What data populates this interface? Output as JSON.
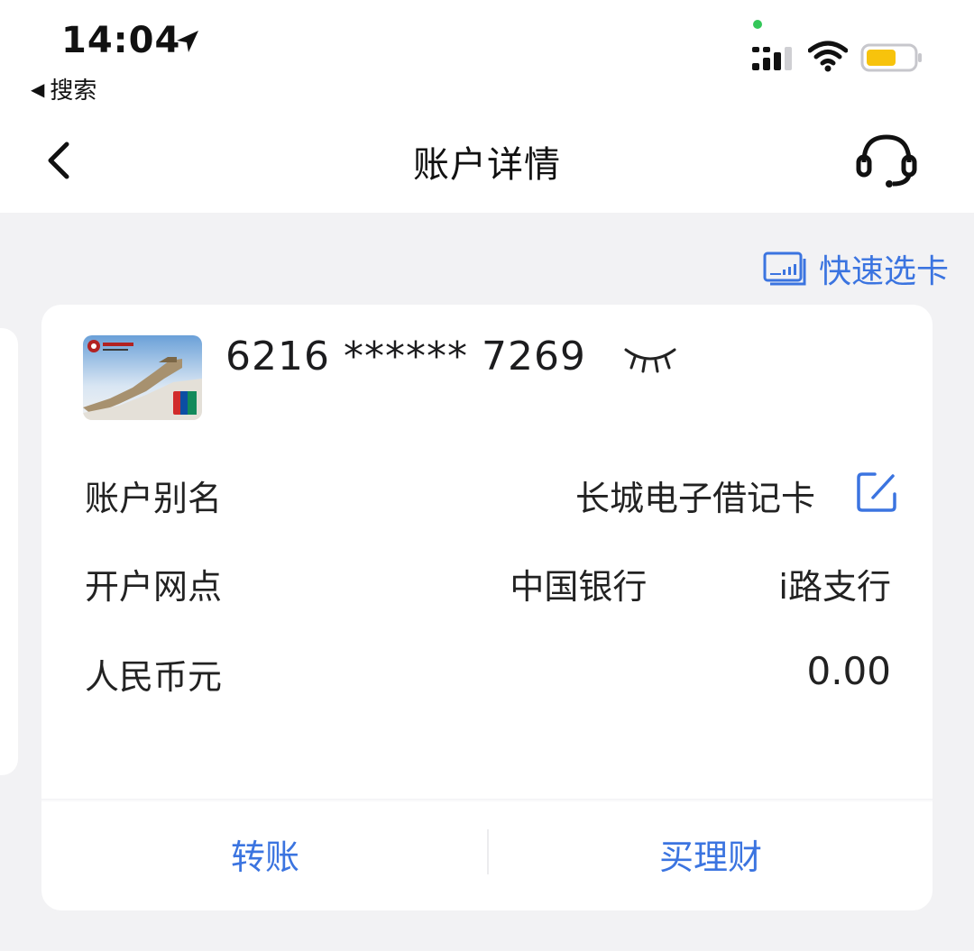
{
  "status_bar": {
    "time": "14:04",
    "back_app_label": "搜索",
    "back_arrow_glyph": "◀"
  },
  "nav": {
    "title": "账户详情"
  },
  "quick_select": {
    "label": "快速选卡"
  },
  "account": {
    "card_number": "6216 ****** 7269",
    "rows": [
      {
        "label": "账户别名",
        "value": "长城电子借记卡"
      },
      {
        "label": "开户网点",
        "value": "中国银行"
      },
      {
        "label": "人民币元",
        "value": "0.00"
      }
    ],
    "branch_suffix": "路支行",
    "branch_partial_char": "i"
  },
  "actions": {
    "transfer": "转账",
    "wealth": "买理财"
  },
  "colors": {
    "accent_blue": "#3b74e0",
    "battery_yellow": "#f7c30c",
    "page_bg": "#f2f2f4"
  }
}
